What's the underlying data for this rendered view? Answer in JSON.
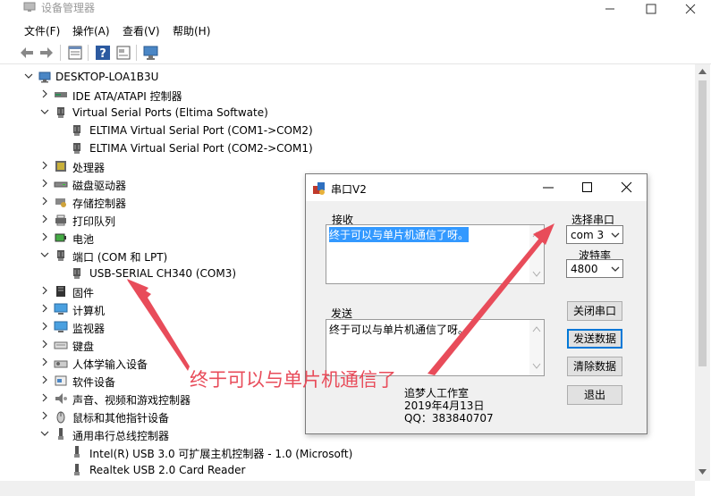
{
  "window": {
    "title": "设备管理器"
  },
  "menu": [
    "文件(F)",
    "操作(A)",
    "查看(V)",
    "帮助(H)"
  ],
  "tree": [
    {
      "label": "DESKTOP-LOA1B3U",
      "level": 0,
      "expanded": true,
      "icon": "computer-icon"
    },
    {
      "label": "IDE ATA/ATAPI 控制器",
      "level": 1,
      "expanded": false,
      "icon": "ide-icon"
    },
    {
      "label": "Virtual Serial Ports (Eltima Softwate)",
      "level": 1,
      "expanded": true,
      "icon": "port-icon"
    },
    {
      "label": "ELTIMA Virtual Serial Port (COM1->COM2)",
      "level": 2,
      "icon": "port-icon"
    },
    {
      "label": "ELTIMA Virtual Serial Port (COM2->COM1)",
      "level": 2,
      "icon": "port-icon"
    },
    {
      "label": "处理器",
      "level": 1,
      "expanded": false,
      "icon": "cpu-icon"
    },
    {
      "label": "磁盘驱动器",
      "level": 1,
      "expanded": false,
      "icon": "disk-icon"
    },
    {
      "label": "存储控制器",
      "level": 1,
      "expanded": false,
      "icon": "storage-icon"
    },
    {
      "label": "打印队列",
      "level": 1,
      "expanded": false,
      "icon": "printer-icon"
    },
    {
      "label": "电池",
      "level": 1,
      "expanded": false,
      "icon": "battery-icon"
    },
    {
      "label": "端口 (COM 和 LPT)",
      "level": 1,
      "expanded": true,
      "icon": "port-icon"
    },
    {
      "label": "USB-SERIAL CH340 (COM3)",
      "level": 2,
      "icon": "port-icon"
    },
    {
      "label": "固件",
      "level": 1,
      "expanded": false,
      "icon": "firmware-icon"
    },
    {
      "label": "计算机",
      "level": 1,
      "expanded": false,
      "icon": "monitor-icon"
    },
    {
      "label": "监视器",
      "level": 1,
      "expanded": false,
      "icon": "monitor-icon"
    },
    {
      "label": "键盘",
      "level": 1,
      "expanded": false,
      "icon": "keyboard-icon"
    },
    {
      "label": "人体学输入设备",
      "level": 1,
      "expanded": false,
      "icon": "hid-icon"
    },
    {
      "label": "软件设备",
      "level": 1,
      "expanded": false,
      "icon": "software-icon"
    },
    {
      "label": "声音、视频和游戏控制器",
      "level": 1,
      "expanded": false,
      "icon": "sound-icon"
    },
    {
      "label": "鼠标和其他指针设备",
      "level": 1,
      "expanded": false,
      "icon": "mouse-icon"
    },
    {
      "label": "通用串行总线控制器",
      "level": 1,
      "expanded": true,
      "icon": "usb-icon"
    },
    {
      "label": "Intel(R) USB 3.0 可扩展主机控制器 - 1.0 (Microsoft)",
      "level": 2,
      "icon": "usb-icon"
    },
    {
      "label": "Realtek USB 2.0 Card Reader",
      "level": 2,
      "icon": "usb-icon"
    }
  ],
  "dialog": {
    "title": "串口V2",
    "receive_label": "接收",
    "receive_text": "终于可以与单片机通信了呀。",
    "send_label": "发送",
    "send_text": "终于可以与单片机通信了呀。",
    "port_label": "选择串口",
    "port_value": "com 3",
    "baud_label": "波特率",
    "baud_value": "4800",
    "btn_close_port": "关闭串口",
    "btn_send": "发送数据",
    "btn_clear": "清除数据",
    "btn_exit": "退出",
    "studio": "追梦人工作室",
    "date": "2019年4月13日",
    "qq": "QQ：383840707"
  },
  "annotation": "终于可以与单片机通信了",
  "colors": {
    "annotation": "#e84c5a",
    "selection": "#3399ff",
    "focus": "#0078d7"
  }
}
